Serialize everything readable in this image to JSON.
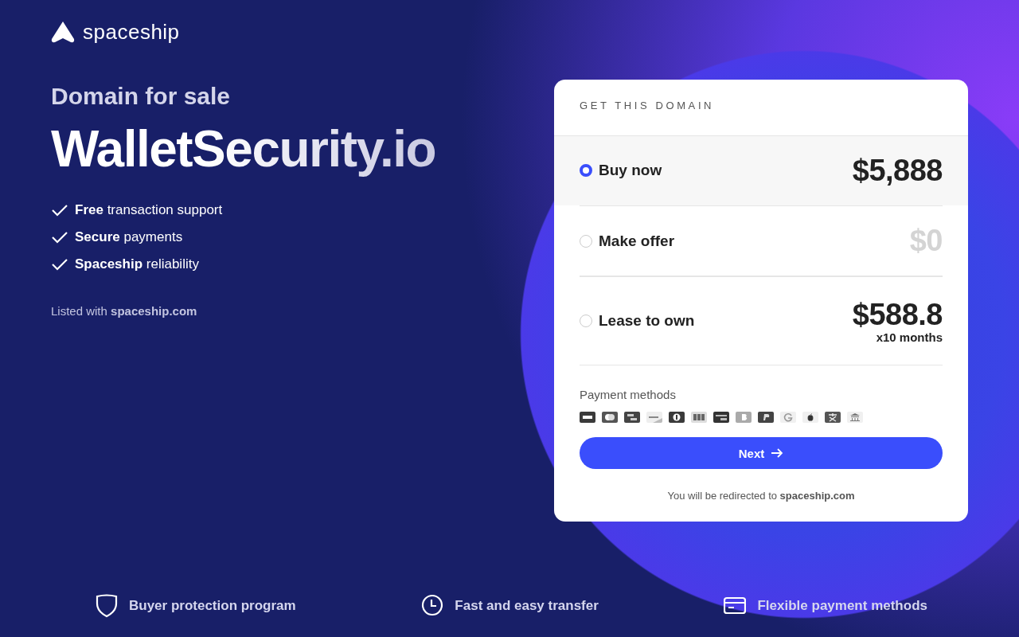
{
  "brand": {
    "name": "spaceship"
  },
  "hero": {
    "eyebrow": "Domain for sale",
    "domain": "WalletSecurity.io",
    "benefits": [
      "**Free** transaction support",
      "**Secure** payments",
      "**Spaceship** reliability"
    ],
    "listed": "Listed with **spaceship.com**"
  },
  "card": {
    "title": "GET THIS DOMAIN",
    "options": [
      {
        "kind": "fixed",
        "label": "Buy now",
        "price": "$5,888",
        "selected": true
      },
      {
        "kind": "offer",
        "label": "Make offer",
        "price": "$0",
        "selected": false
      },
      {
        "kind": "lease",
        "label": "Lease to own",
        "price": "$588.8",
        "term": "x10 months",
        "selected": false
      }
    ],
    "payment_label": "Payment methods",
    "button": "Next",
    "redirect": "You will be redirected to **spaceship.com**"
  },
  "features": [
    {
      "kind": "shield",
      "label": "Buyer protection program"
    },
    {
      "kind": "clock",
      "label": "Fast and easy transfer"
    },
    {
      "kind": "card",
      "label": "Flexible payment methods"
    }
  ]
}
